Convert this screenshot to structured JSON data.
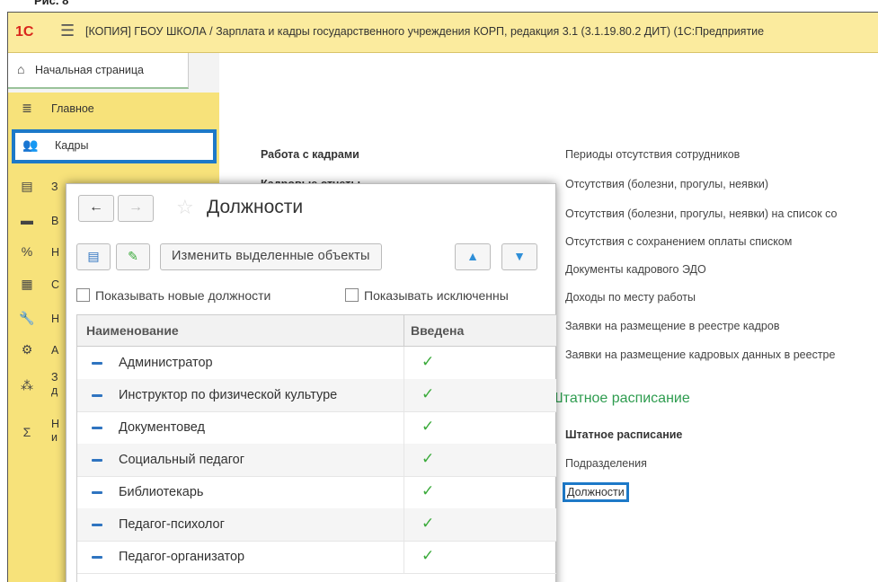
{
  "corner_text": "Рис. 8",
  "titlebar": {
    "logo": "1С",
    "menu_icon": "hamburger-menu-icon",
    "title": "[КОПИЯ] ГБОУ ШКОЛА / Зарплата и кадры государственного учреждения КОРП, редакция 3.1 (3.1.19.80.2 ДИТ)  (1С:Предприятие"
  },
  "home_tab": {
    "label": "Начальная страница",
    "icon": "home-icon"
  },
  "sidebar": {
    "items": [
      {
        "label": "Главное",
        "icon": "list-icon"
      },
      {
        "label": "Кадры",
        "icon": "people-icon",
        "active": true
      },
      {
        "label": "З",
        "icon": "calculator-icon"
      },
      {
        "label": "В",
        "icon": "card-icon"
      },
      {
        "label": "Н",
        "icon": "percent-icon"
      },
      {
        "label": "С",
        "icon": "document-icon"
      },
      {
        "label": "Н",
        "icon": "wrench-icon"
      },
      {
        "label": "А",
        "icon": "gear-icon"
      },
      {
        "label": "З\nд",
        "icon": "structure-icon"
      },
      {
        "label": "Н\nи",
        "icon": "sigma-icon"
      }
    ]
  },
  "main": {
    "left_links": [
      "Работа с кадрами",
      "Кадровые отчеты"
    ],
    "right_links": [
      "Периоды отсутствия сотрудников",
      "Отсутствия (болезни, прогулы, неявки)",
      "Отсутствия (болезни, прогулы, неявки) на список со",
      "Отсутствия с сохранением оплаты списком",
      "Документы кадрового ЭДО",
      "Доходы по месту работы",
      "Заявки на размещение в реестре кадров",
      "Заявки на размещение кадровых данных в реестре"
    ],
    "section_title": "Штатное расписание",
    "section_links": [
      "Штатное расписание",
      "Подразделения",
      "Должности"
    ]
  },
  "dialog": {
    "title": "Должности",
    "back_icon": "arrow-left-icon",
    "forward_icon": "arrow-right-icon",
    "star_icon": "star-icon",
    "toolbar": {
      "change_selected": "Изменить выделенные объекты",
      "btn1_icon": "list-icon",
      "btn2_icon": "edit-icon",
      "up_icon": "arrow-up-icon",
      "down_icon": "arrow-down-icon"
    },
    "show_new": "Показывать новые должности",
    "show_excluded": "Показывать исключенны",
    "columns": {
      "name": "Наименование",
      "entered": "Введена"
    },
    "rows": [
      {
        "name": "Администратор",
        "entered": "✓"
      },
      {
        "name": "Инструктор по физической культуре",
        "entered": "✓"
      },
      {
        "name": "Документовед",
        "entered": "✓"
      },
      {
        "name": "Социальный педагог",
        "entered": "✓"
      },
      {
        "name": "Библиотекарь",
        "entered": "✓"
      },
      {
        "name": "Педагог-психолог",
        "entered": "✓"
      },
      {
        "name": "Педагог-организатор",
        "entered": "✓"
      }
    ]
  }
}
